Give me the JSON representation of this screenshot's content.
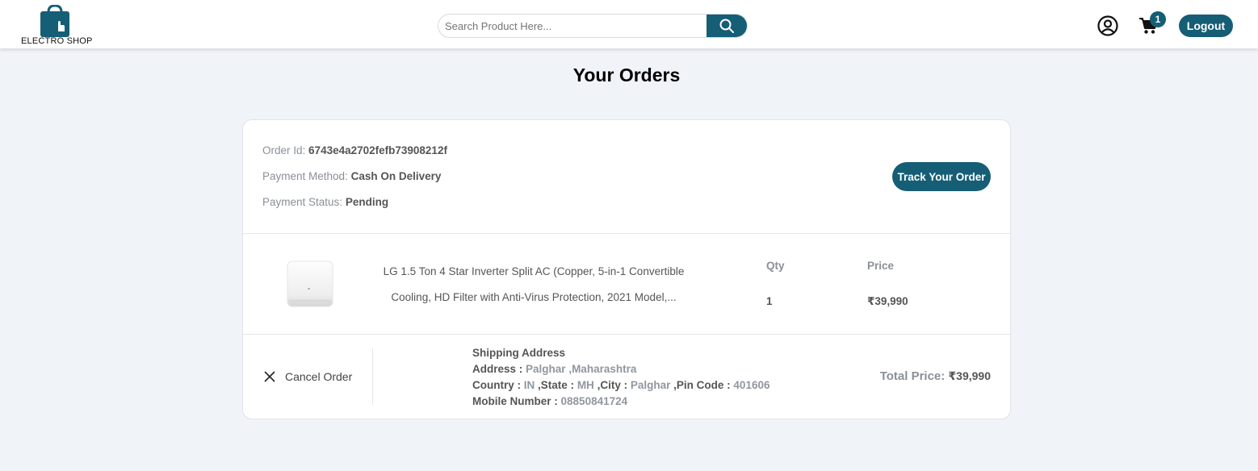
{
  "header": {
    "logo_text": "ELECTRO SHOP",
    "search_placeholder": "Search Product Here...",
    "cart_count": "1",
    "logout_label": "Logout",
    "accent_color": "#155e75"
  },
  "page": {
    "title": "Your Orders"
  },
  "order": {
    "id_label": "Order Id:",
    "id_value": "6743e4a2702fefb73908212f",
    "payment_method_label": "Payment Method:",
    "payment_method_value": "Cash On Delivery",
    "payment_status_label": "Payment Status:",
    "payment_status_value": "Pending",
    "track_label": "Track Your Order",
    "item": {
      "name_line1": "LG 1.5 Ton 4 Star Inverter Split AC (Copper, 5-in-1 Convertible",
      "name_line2": "Cooling, HD Filter with Anti-Virus Protection, 2021 Model,...",
      "qty_label": "Qty",
      "qty_value": "1",
      "price_label": "Price",
      "price_value": "₹39,990"
    },
    "cancel_label": "Cancel Order",
    "shipping": {
      "heading": "Shipping Address",
      "address_label": "Address :",
      "address_value": "Palghar ,Maharashtra",
      "country_label": "Country :",
      "country_value": "IN",
      "state_label": ",State :",
      "state_value": "MH",
      "city_label": ",City :",
      "city_value": "Palghar",
      "pincode_label": ",Pin Code :",
      "pincode_value": "401606",
      "mobile_label": "Mobile Number :",
      "mobile_value": "08850841724"
    },
    "total_label": "Total Price:",
    "total_value": "₹39,990"
  }
}
